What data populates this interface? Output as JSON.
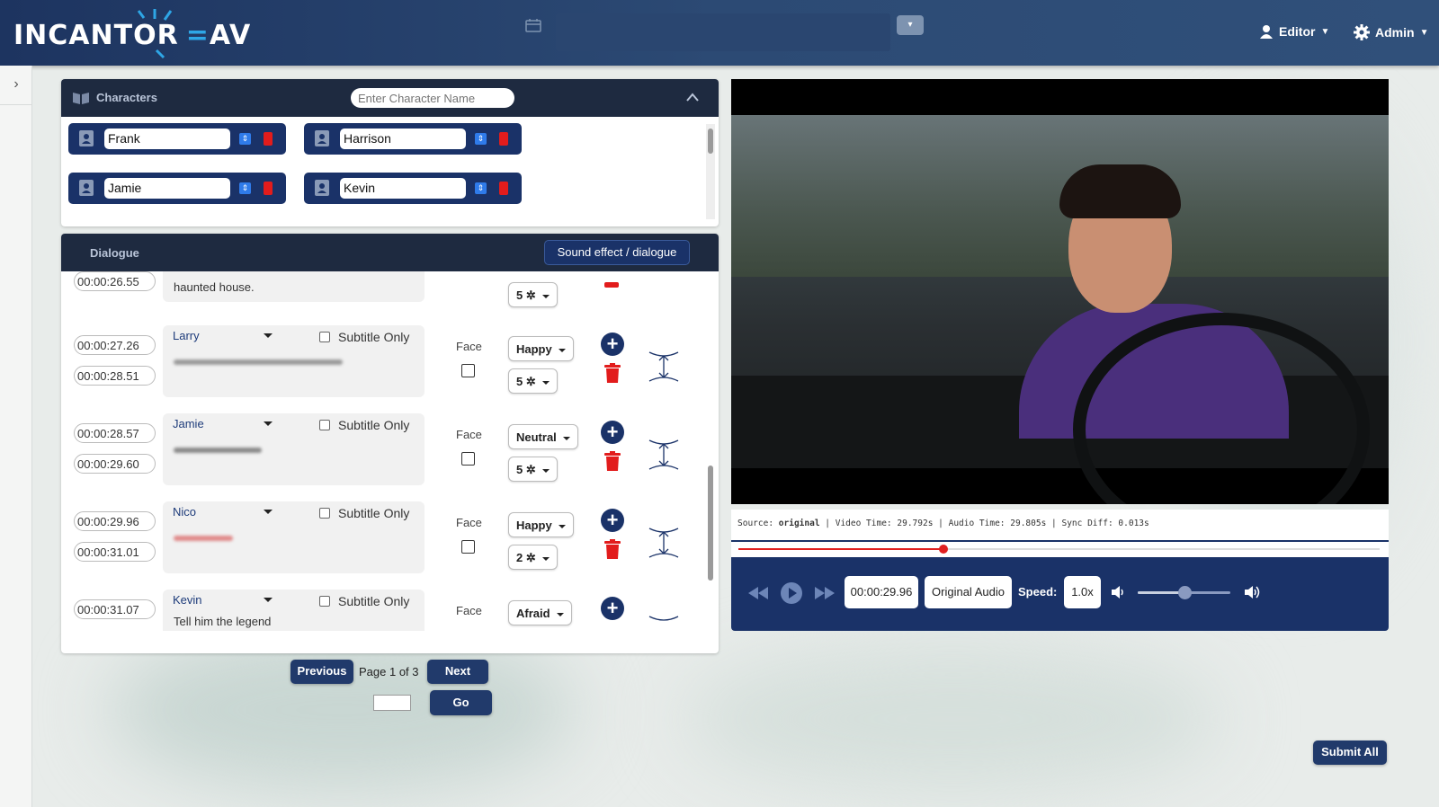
{
  "header": {
    "logo_left": "INCANTOR",
    "logo_right": "AV",
    "editor_label": "Editor",
    "admin_label": "Admin"
  },
  "characters": {
    "title": "Characters",
    "input_placeholder": "Enter Character Name",
    "items": [
      {
        "name": "Frank"
      },
      {
        "name": "Harrison"
      },
      {
        "name": "Jamie"
      },
      {
        "name": "Kevin"
      }
    ]
  },
  "dialogue": {
    "title": "Dialogue",
    "sound_button": "Sound effect / dialogue",
    "partial_top_text": "haunted house.",
    "partial_top_time": "00:00:26.55",
    "partial_top_rating": "5",
    "face_label": "Face",
    "subtitle_label": "Subtitle Only",
    "rows": [
      {
        "start": "00:00:27.26",
        "end": "00:00:28.51",
        "speaker": "Larry",
        "emotion": "Happy",
        "rating": "5"
      },
      {
        "start": "00:00:28.57",
        "end": "00:00:29.60",
        "speaker": "Jamie",
        "emotion": "Neutral",
        "rating": "5"
      },
      {
        "start": "00:00:29.96",
        "end": "00:00:31.01",
        "speaker": "Nico",
        "emotion": "Happy",
        "rating": "2"
      },
      {
        "start": "00:00:31.07",
        "end": "",
        "speaker": "Kevin",
        "emotion": "Afraid",
        "rating": "",
        "partial_text": "Tell him the legend"
      }
    ]
  },
  "pager": {
    "previous": "Previous",
    "page_text": "Page 1 of 3",
    "next": "Next",
    "go": "Go",
    "page_input": ""
  },
  "player": {
    "source_label": "Source:",
    "source_value": "original",
    "video_time_label": "Video Time:",
    "video_time": "29.792s",
    "audio_time_label": "Audio Time:",
    "audio_time": "29.805s",
    "sync_label": "Sync Diff:",
    "sync_diff": "0.013s",
    "progress": 0.32,
    "current_time": "00:00:29.96",
    "audio_track": "Original Audio",
    "speed_label": "Speed:",
    "speed": "1.0x",
    "volume": 0.5
  },
  "submit_all": "Submit All",
  "colors": {
    "navy": "#1a3268",
    "header": "#1e2a40",
    "delete_red": "#e21c1c",
    "seek_red": "#e02020"
  }
}
